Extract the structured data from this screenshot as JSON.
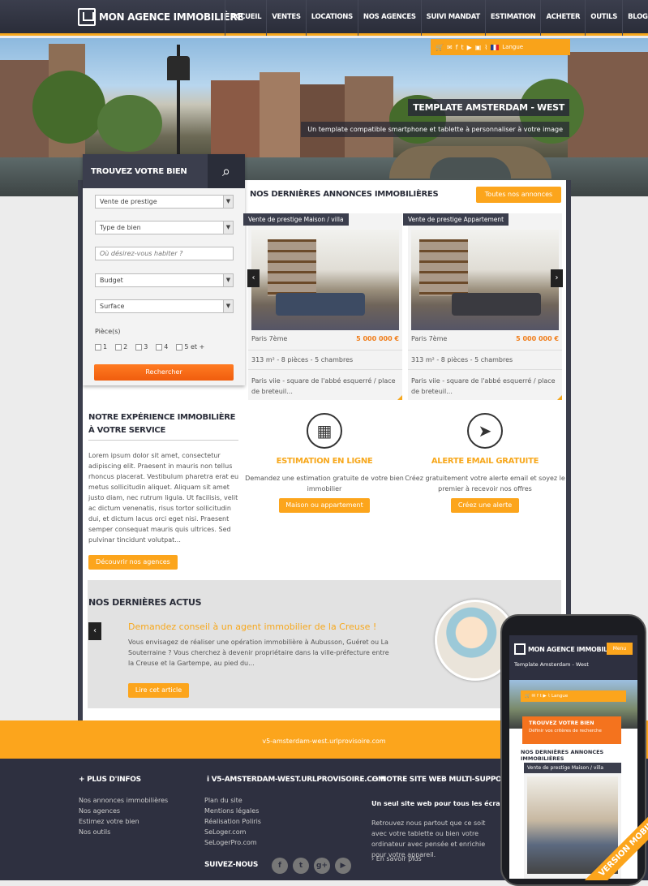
{
  "header": {
    "logo_text": "MON AGENCE IMMOBILIÈRE",
    "nav": [
      "ACCUEIL",
      "VENTES",
      "LOCATIONS",
      "NOS AGENCES",
      "SUIVI MANDAT",
      "ESTIMATION",
      "ACHETER",
      "OUTILS",
      "BLOG"
    ]
  },
  "hero": {
    "icons": [
      "cart-icon",
      "mail-icon",
      "facebook-icon",
      "twitter-icon",
      "video-icon",
      "rss-icon",
      "flag-fr-icon"
    ],
    "language_label": "Langue",
    "template_title": "TEMPLATE AMSTERDAM - WEST",
    "template_subtitle": "Un template compatible smartphone et tablette à personnaliser à votre image"
  },
  "search": {
    "title": "TROUVEZ VOTRE BIEN",
    "category_value": "Vente de prestige",
    "type_value": "Type de bien",
    "location_placeholder": "Où désirez-vous habiter ?",
    "budget_value": "Budget",
    "surface_value": "Surface",
    "pieces_label": "Pièce(s)",
    "pieces_options": [
      "1",
      "2",
      "3",
      "4",
      "5 et +"
    ],
    "button": "Rechercher"
  },
  "listings": {
    "title": "NOS DERNIÈRES ANNONCES IMMOBILIÈRES",
    "all_button": "Toutes nos annonces",
    "cards": [
      {
        "tag": "Vente de prestige Maison / villa",
        "city": "Paris 7ème",
        "price": "5 000 000 €",
        "details": "313 m² - 8 pièces - 5 chambres",
        "desc": "Paris viie - square de l'abbé esquerré / place de breteuil..."
      },
      {
        "tag": "Vente de prestige Appartement",
        "city": "Paris 7ème",
        "price": "5 000 000 €",
        "details": "313 m² - 8 pièces - 5 chambres",
        "desc": "Paris viie - square de l'abbé esquerré / place de breteuil..."
      }
    ]
  },
  "services": [
    {
      "icon": "calculator-icon",
      "title": "ESTIMATION EN LIGNE",
      "desc": "Demandez une estimation gratuite de votre bien immobilier",
      "button": "Maison ou appartement"
    },
    {
      "icon": "paper-plane-icon",
      "title": "ALERTE EMAIL GRATUITE",
      "desc": "Créez gratuitement votre alerte email et soyez le premier à recevoir nos offres",
      "button": "Créez une alerte"
    }
  ],
  "experience": {
    "title": "NOTRE EXPÉRIENCE IMMOBILIÈRE À VOTRE SERVICE",
    "text": "Lorem ipsum dolor sit amet, consectetur adipiscing elit. Praesent in mauris non tellus rhoncus placerat. Vestibulum pharetra erat eu metus sollicitudin aliquet. Aliquam sit amet justo diam, nec rutrum ligula. Ut facilisis, velit ac dictum venenatis, risus tortor sollicitudin dui, et dictum lacus orci eget nisi. Praesent semper consequat mauris quis ultrices. Sed pulvinar tincidunt volutpat...",
    "button": "Découvrir nos agences"
  },
  "news": {
    "title": "NOS DERNIÈRES ACTUS",
    "headline": "Demandez conseil à un agent immobilier de la Creuse !",
    "text": "Vous envisagez de réaliser une opération immobilière à Aubusson, Guéret ou La Souterraine ? Vous cherchez à devenir propriétaire dans la ville-préfecture entre la Creuse et la Gartempe, au pied du...",
    "button": "Lire cet article"
  },
  "footer": {
    "url": "v5-amsterdam-west.urlprovisoire.com",
    "col1_title": "PLUS D'INFOS",
    "col1_links": [
      "Nos annonces immobilières",
      "Nos agences",
      "Estimez votre bien",
      "Nos outils"
    ],
    "col2_title": "V5-AMSTERDAM-WEST.URLPROVISOIRE.COM",
    "col2_links": [
      "Plan du site",
      "Mentions légales",
      "Réalisation Poliris",
      "SeLoger.com",
      "SeLogerPro.com"
    ],
    "follow_label": "SUIVEZ-NOUS",
    "social": [
      "f",
      "t",
      "g+",
      "▶"
    ],
    "col3_title": "NOTRE SITE WEB MULTI-SUPPORTS",
    "col3_sub": "Un seul site web pour tous les écrans",
    "col3_text": "Retrouvez nous partout que ce soit avec votre tablette ou bien votre ordinateur avec pensée et enrichie pour votre appareil.",
    "col3_more": "En savoir plus"
  },
  "mobile": {
    "logo_text": "MON AGENCE IMMOBILIÈRE",
    "menu": "Menu",
    "subtitle": "Template Amsterdam - West",
    "language_label": "Langue",
    "search_title": "TROUVEZ VOTRE BIEN",
    "search_sub": "Définir vos critères de recherche",
    "list_title": "NOS DERNIÈRES ANNONCES IMMOBILIÈRES",
    "card_tag": "Vente de prestige Maison / villa",
    "ribbon": "VERSION MOBILE"
  }
}
